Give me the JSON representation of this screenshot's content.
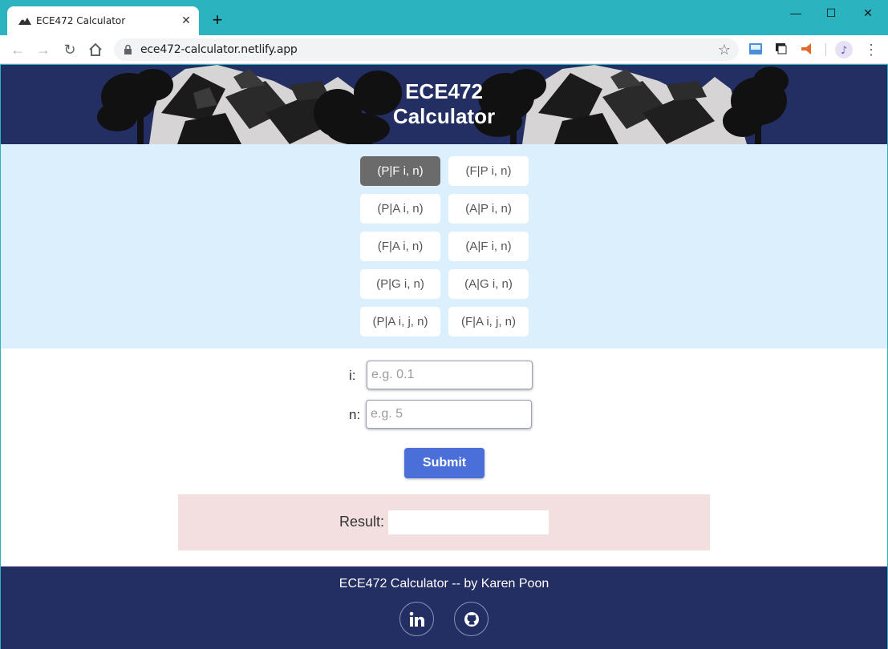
{
  "browser": {
    "tab_title": "ECE472 Calculator",
    "url": "ece472-calculator.netlify.app"
  },
  "page": {
    "header_title_line1": "ECE472",
    "header_title_line2": "Calculator",
    "factor_buttons": [
      {
        "label": "(P|F i, n)",
        "active": true
      },
      {
        "label": "(F|P i, n)",
        "active": false
      },
      {
        "label": "(P|A i, n)",
        "active": false
      },
      {
        "label": "(A|P i, n)",
        "active": false
      },
      {
        "label": "(F|A i, n)",
        "active": false
      },
      {
        "label": "(A|F i, n)",
        "active": false
      },
      {
        "label": "(P|G i, n)",
        "active": false
      },
      {
        "label": "(A|G i, n)",
        "active": false
      },
      {
        "label": "(P|A i, j, n)",
        "active": false
      },
      {
        "label": "(F|A i, j, n)",
        "active": false
      }
    ],
    "form": {
      "i_label": "i:",
      "i_placeholder": "e.g. 0.1",
      "n_label": "n:",
      "n_placeholder": "e.g. 5",
      "submit_label": "Submit"
    },
    "result": {
      "label": "Result:",
      "value": ""
    },
    "footer": {
      "text": "ECE472 Calculator -- by Karen Poon",
      "links": [
        "linkedin-icon",
        "github-icon"
      ]
    }
  },
  "colors": {
    "header_bg": "#232e63",
    "buttons_bg": "#dceffc",
    "active_button": "#6b6b6b",
    "submit": "#4a6fd8",
    "result_bg": "#f3dfdf",
    "chrome": "#2bb3c0"
  }
}
